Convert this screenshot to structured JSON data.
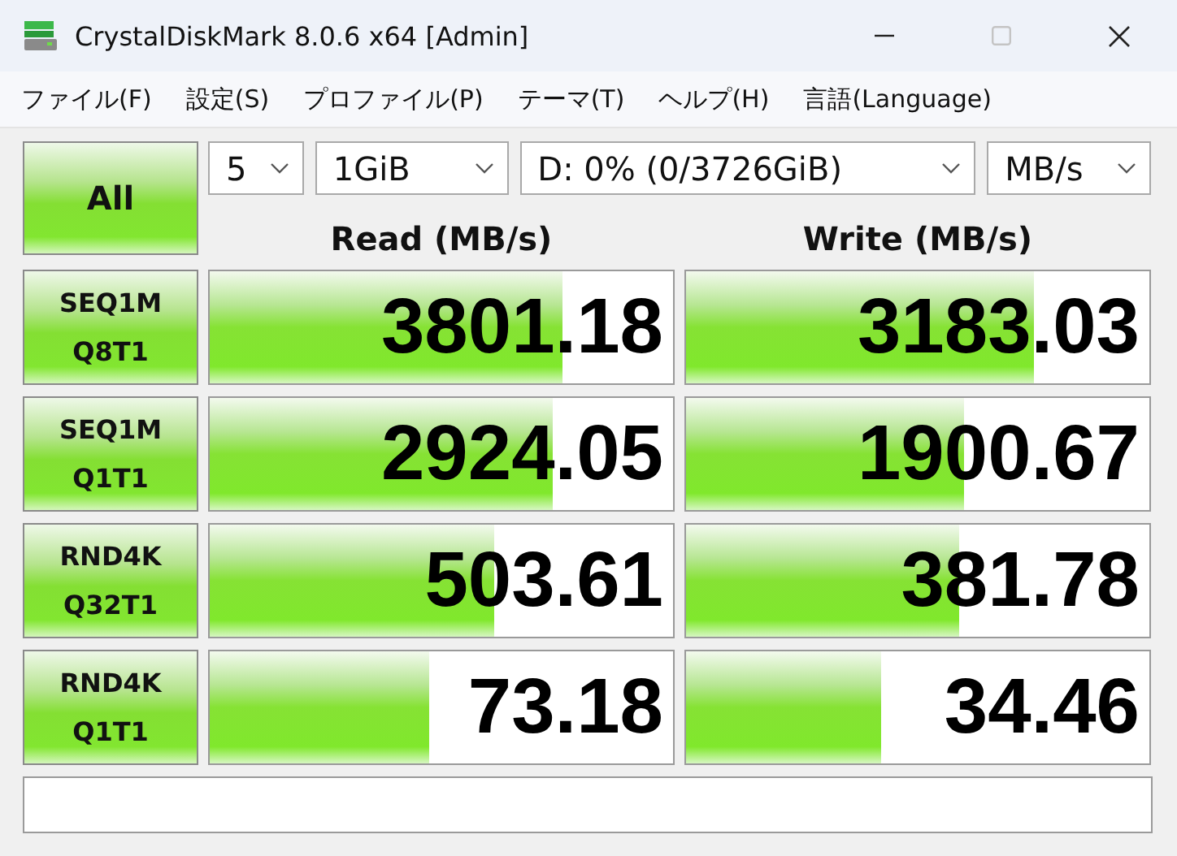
{
  "window": {
    "title": "CrystalDiskMark 8.0.6 x64 [Admin]"
  },
  "title_buttons": [
    {
      "kind": "minimize",
      "disabled": false
    },
    {
      "kind": "maximize",
      "disabled": true
    },
    {
      "kind": "close",
      "disabled": false
    }
  ],
  "menu": [
    "ファイル(F)",
    "設定(S)",
    "プロファイル(P)",
    "テーマ(T)",
    "ヘルプ(H)",
    "言語(Language)"
  ],
  "all_button": "All",
  "settings": [
    {
      "value": "5"
    },
    {
      "value": "1GiB"
    },
    {
      "value": "D: 0% (0/3726GiB)"
    },
    {
      "value": "MB/s"
    }
  ],
  "columns": [
    "Read (MB/s)",
    "Write (MB/s)"
  ],
  "results": [
    {
      "test": "SEQ1M",
      "params": "Q8T1",
      "read": {
        "value": "3801.18",
        "level": 0.76
      },
      "write": {
        "value": "3183.03",
        "level": 0.75
      }
    },
    {
      "test": "SEQ1M",
      "params": "Q1T1",
      "read": {
        "value": "2924.05",
        "level": 0.74
      },
      "write": {
        "value": "1900.67",
        "level": 0.6
      }
    },
    {
      "test": "RND4K",
      "params": "Q32T1",
      "read": {
        "value": "503.61",
        "level": 0.615
      },
      "write": {
        "value": "381.78",
        "level": 0.59
      }
    },
    {
      "test": "RND4K",
      "params": "Q1T1",
      "read": {
        "value": "73.18",
        "level": 0.475
      },
      "write": {
        "value": "34.46",
        "level": 0.42
      }
    }
  ]
}
